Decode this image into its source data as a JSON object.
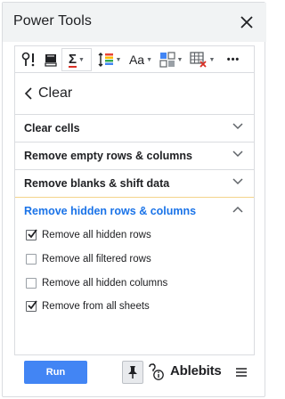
{
  "window": {
    "title": "Power Tools"
  },
  "toolbar": {
    "buttons": [
      {
        "name": "find-replace",
        "icon": "find-replace-icon"
      },
      {
        "name": "clear-format",
        "icon": "clear-format-icon"
      },
      {
        "name": "sum-functions",
        "icon": "sigma-icon",
        "label": "Σ"
      },
      {
        "name": "row-height",
        "icon": "row-height-icon"
      },
      {
        "name": "text-case",
        "icon": "text-case-icon",
        "label": "Aa"
      },
      {
        "name": "split-merge",
        "icon": "split-merge-icon"
      },
      {
        "name": "remove-table",
        "icon": "table-remove-icon"
      },
      {
        "name": "more",
        "icon": "more-icon",
        "label": "•••"
      }
    ]
  },
  "panel": {
    "back_label": "Clear",
    "sections": [
      {
        "label": "Clear cells",
        "expanded": false
      },
      {
        "label": "Remove empty rows & columns",
        "expanded": false
      },
      {
        "label": "Remove blanks & shift data",
        "expanded": false
      },
      {
        "label": "Remove hidden rows & columns",
        "expanded": true
      }
    ],
    "options": [
      {
        "label": "Remove all hidden rows",
        "checked": true
      },
      {
        "label": "Remove all filtered rows",
        "checked": false
      },
      {
        "label": "Remove all hidden columns",
        "checked": false
      },
      {
        "label": "Remove from all sheets",
        "checked": true
      }
    ]
  },
  "footer": {
    "run_label": "Run",
    "brand": "Ablebits",
    "pin_icon": "pin-icon",
    "help_icon": "help-info-icon",
    "menu_icon": "hamburger-menu-icon"
  },
  "colors": {
    "accent": "#4285f4",
    "link_blue": "#1a73e8",
    "active_border": "#f4d48a",
    "title_bg": "#f1f3f4"
  }
}
